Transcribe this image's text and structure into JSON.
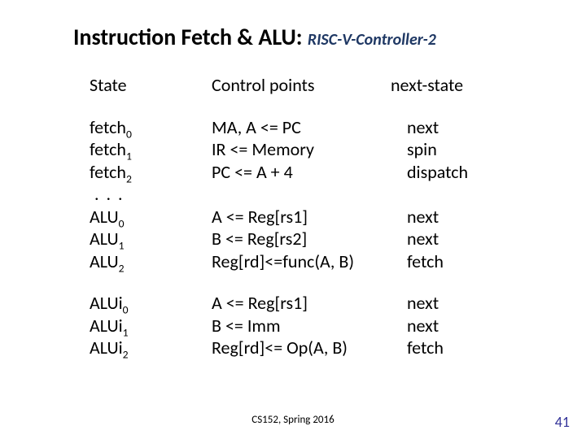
{
  "title": {
    "main": "Instruction Fetch & ALU:",
    "accent": "RISC-V-Controller-2"
  },
  "headers": {
    "state": "State",
    "cp": "Control points",
    "ns": "next-state"
  },
  "fetch": {
    "states": [
      "fetch",
      "fetch",
      "fetch"
    ],
    "subs": [
      "0",
      "1",
      "2"
    ],
    "ellipsis": ". . .",
    "cps": [
      "MA, A <= PC",
      "IR  <= Memory",
      "PC <= A + 4"
    ],
    "ns": [
      "next",
      "spin",
      "dispatch"
    ]
  },
  "alu": {
    "states": [
      "ALU",
      "ALU",
      "ALU"
    ],
    "subs": [
      "0",
      "1",
      "2"
    ],
    "cps": [
      "A   <= Reg[rs1]",
      "B   <= Reg[rs2]",
      "Reg[rd]<=func(A, B)"
    ],
    "ns": [
      "next",
      "next",
      "fetch"
    ]
  },
  "alui": {
    "states": [
      "ALUi",
      "ALUi",
      "ALUi"
    ],
    "subs": [
      "0",
      "1",
      "2"
    ],
    "cps": [
      "A <= Reg[rs1]",
      "B <= Imm",
      "Reg[rd]<= Op(A, B)"
    ],
    "ns": [
      "next",
      "next",
      "fetch"
    ]
  },
  "footer": {
    "center": "CS152, Spring 2016",
    "right": "41"
  }
}
